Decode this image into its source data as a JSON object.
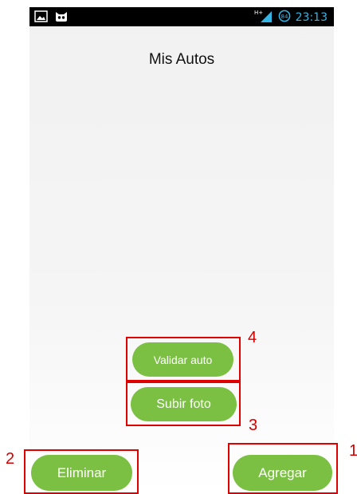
{
  "status_bar": {
    "time": "23:13",
    "network_label": "H+",
    "notification_badge": "84",
    "left_icons": [
      "image-icon",
      "android-cat-icon"
    ],
    "right_icons": [
      "signal-icon",
      "data-icon"
    ],
    "background_color": "#000000",
    "accent_color": "#33b5e5"
  },
  "screen": {
    "title": "Mis Autos"
  },
  "buttons": {
    "validar_label": "Validar auto",
    "subir_label": "Subir foto",
    "eliminar_label": "Eliminar",
    "agregar_label": "Agregar",
    "button_color": "#7bc043"
  },
  "annotations": {
    "callout_1": "1",
    "callout_2": "2",
    "callout_3": "3",
    "callout_4": "4",
    "box_color": "#e00000"
  }
}
